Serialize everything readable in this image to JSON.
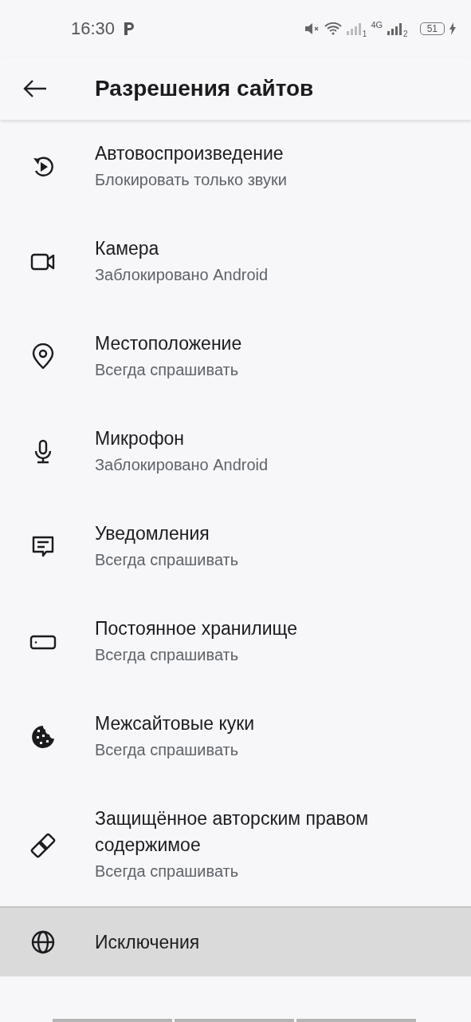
{
  "status_bar": {
    "time": "16:30",
    "network_label": "4G",
    "sim_1": "1",
    "sim_2": "2",
    "battery": "51"
  },
  "toolbar": {
    "title": "Разрешения сайтов"
  },
  "items": [
    {
      "kind": "autoplay",
      "title": "Автовоспроизведение",
      "subtitle": "Блокировать только звуки",
      "selected": false
    },
    {
      "kind": "camera",
      "title": "Камера",
      "subtitle": "Заблокировано Android",
      "selected": false
    },
    {
      "kind": "location",
      "title": "Местоположение",
      "subtitle": "Всегда спрашивать",
      "selected": false
    },
    {
      "kind": "microphone",
      "title": "Микрофон",
      "subtitle": "Заблокировано Android",
      "selected": false
    },
    {
      "kind": "notifications",
      "title": "Уведомления",
      "subtitle": "Всегда спрашивать",
      "selected": false
    },
    {
      "kind": "storage",
      "title": "Постоянное хранилище",
      "subtitle": "Всегда спрашивать",
      "selected": false
    },
    {
      "kind": "cookies",
      "title": "Межсайтовые куки",
      "subtitle": "Всегда спрашивать",
      "selected": false
    },
    {
      "kind": "protected",
      "title": "Защищённое авторским правом содержимое",
      "subtitle": "Всегда спрашивать",
      "selected": false
    },
    {
      "kind": "globe",
      "title": "Исключения",
      "selected": true
    }
  ]
}
